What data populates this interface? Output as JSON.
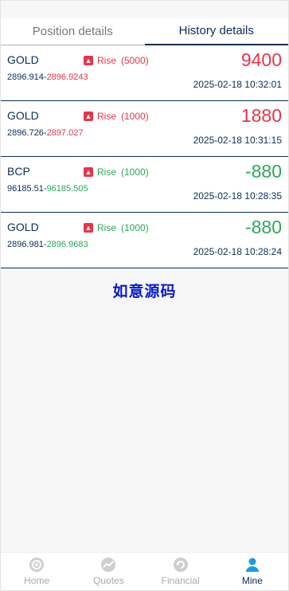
{
  "tabs": [
    {
      "label": "Position details"
    },
    {
      "label": "History details"
    }
  ],
  "records": [
    {
      "symbol": "GOLD",
      "direction": "Rise",
      "amount": "(5000)",
      "open": "2896.914",
      "close": "2896.9243",
      "pnl": "9400",
      "time": "2025-02-18 10:32:01",
      "pnl_color": "#e8344a",
      "label_color": "#e8344a",
      "close_color": "#e8344a"
    },
    {
      "symbol": "GOLD",
      "direction": "Rise",
      "amount": "(1000)",
      "open": "2896.726",
      "close": "2897.027",
      "pnl": "1880",
      "time": "2025-02-18 10:31:15",
      "pnl_color": "#e8344a",
      "label_color": "#e8344a",
      "close_color": "#e8344a"
    },
    {
      "symbol": "BCP",
      "direction": "Rise",
      "amount": "(1000)",
      "open": "96185.51",
      "close": "96185.505",
      "pnl": "-880",
      "time": "2025-02-18 10:28:35",
      "pnl_color": "#2aa95a",
      "label_color": "#2aa95a",
      "close_color": "#2aa95a"
    },
    {
      "symbol": "GOLD",
      "direction": "Rise",
      "amount": "(1000)",
      "open": "2896.981",
      "close": "2896.9683",
      "pnl": "-880",
      "time": "2025-02-18 10:28:24",
      "pnl_color": "#2aa95a",
      "label_color": "#2aa95a",
      "close_color": "#2aa95a"
    }
  ],
  "watermark": "如意源码",
  "nav": [
    {
      "label": "Home",
      "icon": "home-icon"
    },
    {
      "label": "Quotes",
      "icon": "quotes-icon"
    },
    {
      "label": "Financial",
      "icon": "financial-icon"
    },
    {
      "label": "Mine",
      "icon": "user-icon"
    }
  ],
  "colors": {
    "primary": "#0c2d57",
    "rise": "#e8344a",
    "fall": "#2aa95a",
    "nav_active": "#1a9fe0",
    "nav_inactive": "#c4c4c4"
  }
}
